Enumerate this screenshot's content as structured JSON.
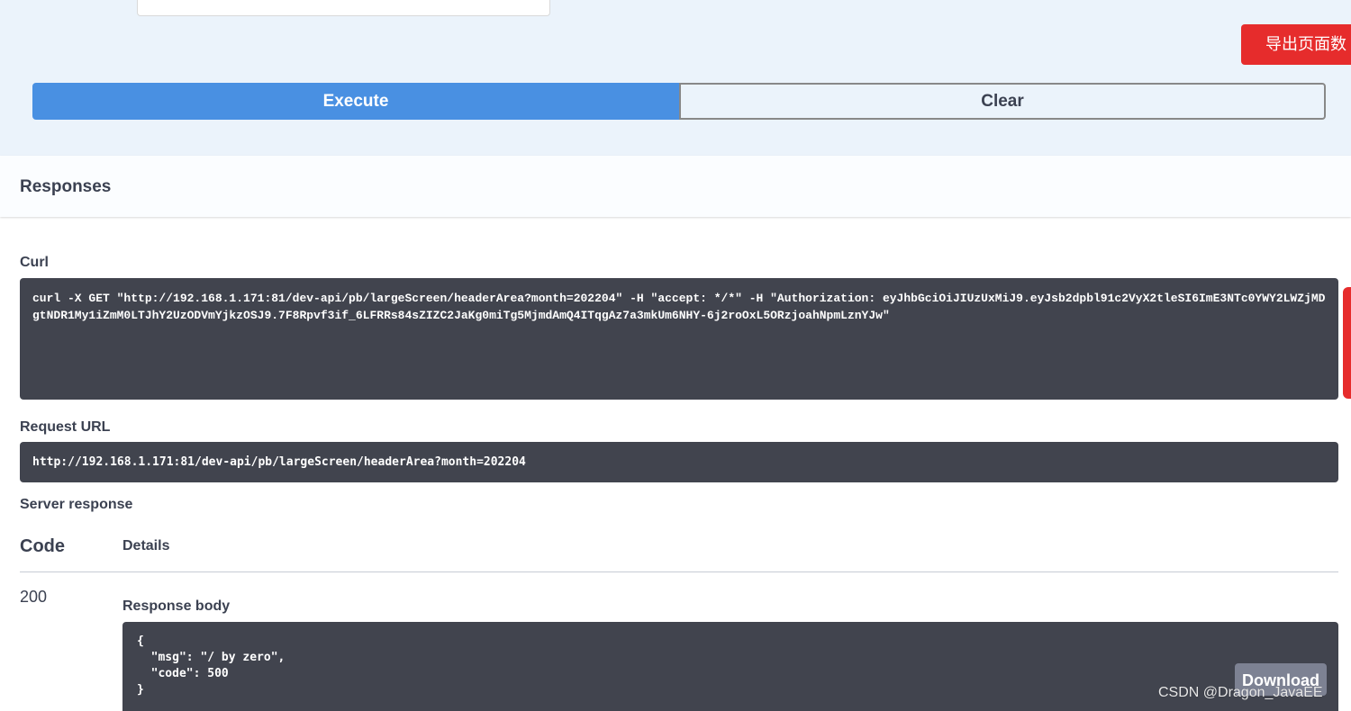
{
  "top": {
    "export_label": "导出页面数",
    "execute_label": "Execute",
    "clear_label": "Clear"
  },
  "responses": {
    "title": "Responses",
    "curl_label": "Curl",
    "curl_text": "curl -X GET \"http://192.168.1.171:81/dev-api/pb/largeScreen/headerArea?month=202204\" -H \"accept: */*\" -H \"Authorization: eyJhbGciOiJIUzUxMiJ9.eyJsb2dpbl91c2VyX2tleSI6ImE3NTc0YWY2LWZjMDgtNDR1My1iZmM0LTJhY2UzODVmYjkzOSJ9.7F8Rpvf3if_6LFRRs84sZIZC2JaKg0miTg5MjmdAmQ4ITqgAz7a3mkUm6NHY-6j2roOxL5ORzjoahNpmLznYJw\"",
    "request_url_label": "Request URL",
    "request_url": "http://192.168.1.171:81/dev-api/pb/largeScreen/headerArea?month=202204",
    "server_response_label": "Server response",
    "col_code": "Code",
    "col_details": "Details",
    "status_code": "200",
    "response_body_label": "Response body",
    "body_lines": [
      "{",
      "  \"msg\": \"/ by zero\",",
      "  \"code\": 500",
      "}"
    ],
    "download_label": "Download"
  },
  "watermark": "CSDN @Dragon_JavaEE",
  "colors": {
    "accent": "#4990e2",
    "danger": "#e62c2c",
    "code_bg": "#41444e",
    "top_bg": "#ebf3fb"
  }
}
